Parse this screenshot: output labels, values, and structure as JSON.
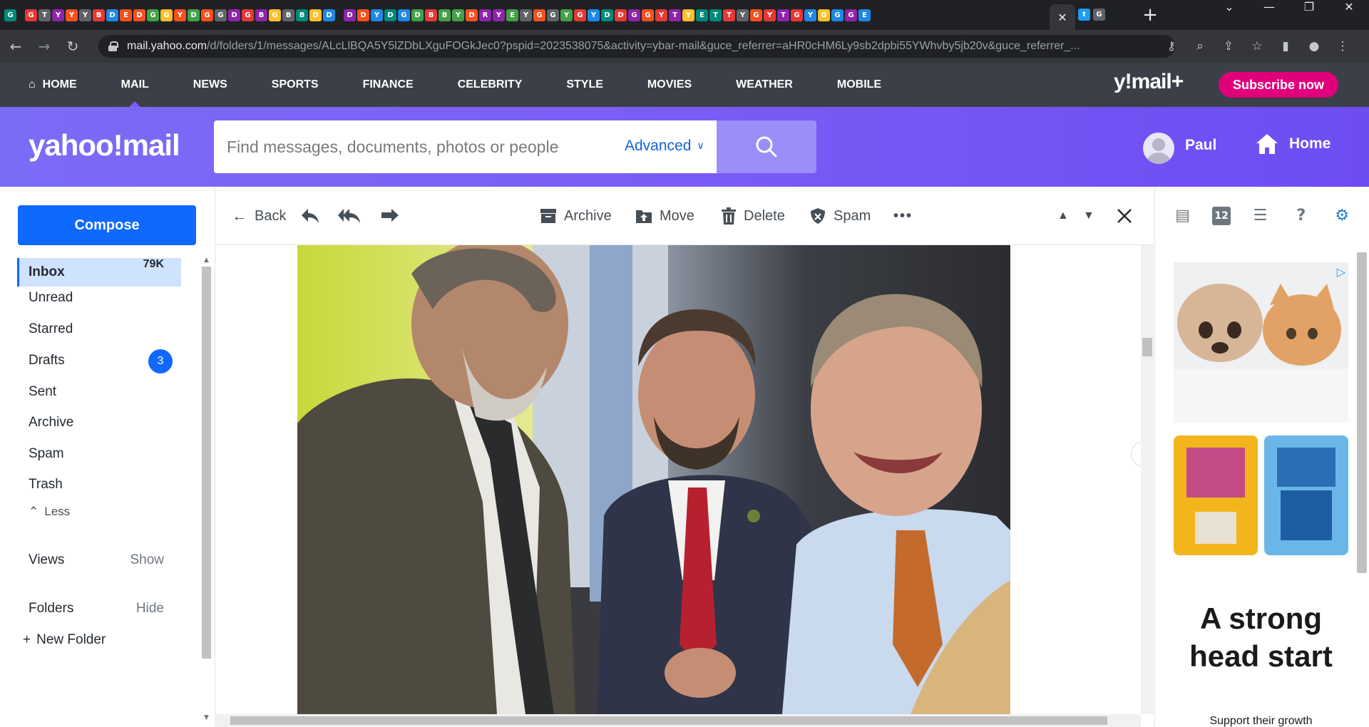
{
  "browser": {
    "url_host": "mail.yahoo.com",
    "url_path": "/d/folders/1/messages/ALcLlBQA5Y5lZDbLXguFOGkJec0?pspid=2023538075&activity=ybar-mail&guce_referrer=aHR0cHM6Ly9sb2dpbi55YWhvby5jb20v&guce_referrer_...",
    "tab_glyphs": [
      "G",
      "G",
      "T",
      "Y",
      "Y",
      "Y",
      "B",
      "D",
      "E",
      "D",
      "G",
      "G",
      "Y",
      "D",
      "G",
      "G",
      "D",
      "G",
      "B",
      "G",
      "B",
      "B",
      "D",
      "D",
      "D",
      "D",
      "Y",
      "D",
      "G",
      "D",
      "B",
      "B",
      "Y",
      "D",
      "R",
      "Y",
      "E",
      "Y",
      "G",
      "G",
      "Y",
      "G",
      "Y",
      "D",
      "D",
      "G",
      "G",
      "Y",
      "T",
      "Y",
      "E",
      "T",
      "T",
      "Y",
      "G",
      "Y",
      "T",
      "G",
      "Y",
      "G",
      "G",
      "G",
      "E"
    ],
    "active_tab_close": "✕",
    "new_tab": "+",
    "window_controls": [
      "⌄",
      "—",
      "❐",
      "✕"
    ]
  },
  "ynav": {
    "items": [
      {
        "label": "HOME",
        "icon": "home-icon"
      },
      {
        "label": "MAIL",
        "active": true
      },
      {
        "label": "NEWS"
      },
      {
        "label": "SPORTS"
      },
      {
        "label": "FINANCE"
      },
      {
        "label": "CELEBRITY"
      },
      {
        "label": "STYLE"
      },
      {
        "label": "MOVIES"
      },
      {
        "label": "WEATHER"
      },
      {
        "label": "MOBILE"
      }
    ],
    "brand": "y!mail+",
    "subscribe": "Subscribe now"
  },
  "header": {
    "logo": "yahoo!mail",
    "search_placeholder": "Find messages, documents, photos or people",
    "advanced_label": "Advanced",
    "user_name": "Paul",
    "home_label": "Home"
  },
  "sidebar": {
    "compose": "Compose",
    "folders": [
      {
        "label": "Inbox",
        "count": "79K",
        "active": true
      },
      {
        "label": "Unread"
      },
      {
        "label": "Starred"
      },
      {
        "label": "Drafts",
        "badge": "3"
      },
      {
        "label": "Sent"
      },
      {
        "label": "Archive"
      },
      {
        "label": "Spam"
      },
      {
        "label": "Trash"
      }
    ],
    "less_label": "Less",
    "views_label": "Views",
    "views_action": "Show",
    "folders_label": "Folders",
    "folders_action": "Hide",
    "new_folder": "New Folder"
  },
  "message_toolbar": {
    "back": "Back",
    "archive": "Archive",
    "move": "Move",
    "delete": "Delete",
    "spam": "Spam",
    "more": "•••"
  },
  "ad": {
    "choice_icon": "ad-choices-icon",
    "headline": "A strong head start",
    "sub": "Support their growth"
  },
  "colors": {
    "nav_bg": "#3b3f48",
    "header_purple": "#7b5cf6",
    "compose_blue": "#0f69ff",
    "subscribe_pink": "#e0007c",
    "inbox_highlight": "#cfe2ff"
  }
}
